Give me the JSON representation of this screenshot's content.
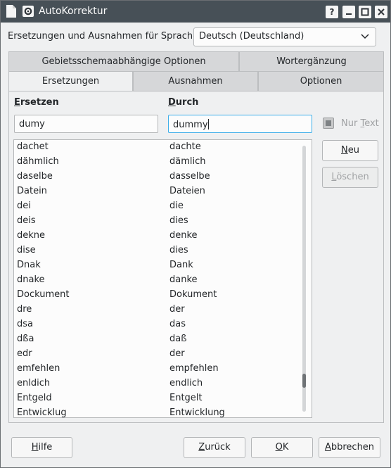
{
  "window": {
    "title": "AutoKorrektur"
  },
  "titlebar": {
    "help_symbol": "?"
  },
  "language": {
    "label": "Ersetzungen und Ausnahmen für Sprache:",
    "value": "Deutsch (Deutschland)"
  },
  "tabs_top": [
    "Gebietsschemaabhängige Optionen",
    "Wortergänzung"
  ],
  "tabs_bottom": [
    "Ersetzungen",
    "Ausnahmen",
    "Optionen"
  ],
  "active_tab": "Ersetzungen",
  "replace": {
    "col1_first": "E",
    "col1_rest": "rsetzen",
    "col2_first": "D",
    "col2_rest": "urch",
    "input1_value": "dumy",
    "input2_value": "dummy"
  },
  "table": [
    [
      "dachet",
      "dachte"
    ],
    [
      "dähmlich",
      "dämlich"
    ],
    [
      "daselbe",
      "dasselbe"
    ],
    [
      "Datein",
      "Dateien"
    ],
    [
      "dei",
      "die"
    ],
    [
      "deis",
      "dies"
    ],
    [
      "dekne",
      "denke"
    ],
    [
      "dise",
      "dies"
    ],
    [
      "Dnak",
      "Dank"
    ],
    [
      "dnake",
      "danke"
    ],
    [
      "Dockument",
      "Dokument"
    ],
    [
      "dre",
      "der"
    ],
    [
      "dsa",
      "das"
    ],
    [
      "dßa",
      "daß"
    ],
    [
      "edr",
      "der"
    ],
    [
      "emfehlen",
      "empfehlen"
    ],
    [
      "enldich",
      "endlich"
    ],
    [
      "Entgeld",
      "Entgelt"
    ],
    [
      "Entwicklug",
      "Entwicklung"
    ]
  ],
  "nur_text": {
    "first": "Nur ",
    "ul": "T",
    "rest": "ext",
    "checked": false,
    "enabled": false
  },
  "side_buttons": {
    "neu": {
      "ul": "N",
      "rest": "eu"
    },
    "loeschen": {
      "ul": "L",
      "rest": "öschen"
    }
  },
  "footer": {
    "hilfe": {
      "ul": "H",
      "rest": "ilfe"
    },
    "zurueck": {
      "ul": "Z",
      "rest": "urück"
    },
    "ok": {
      "ul": "O",
      "rest": "K"
    },
    "abbrechen": {
      "ul": "A",
      "rest": "bbrechen"
    }
  },
  "colors": {
    "titlebar": "#475057",
    "focus": "#3daee9",
    "window_bg": "#eff0f1"
  }
}
